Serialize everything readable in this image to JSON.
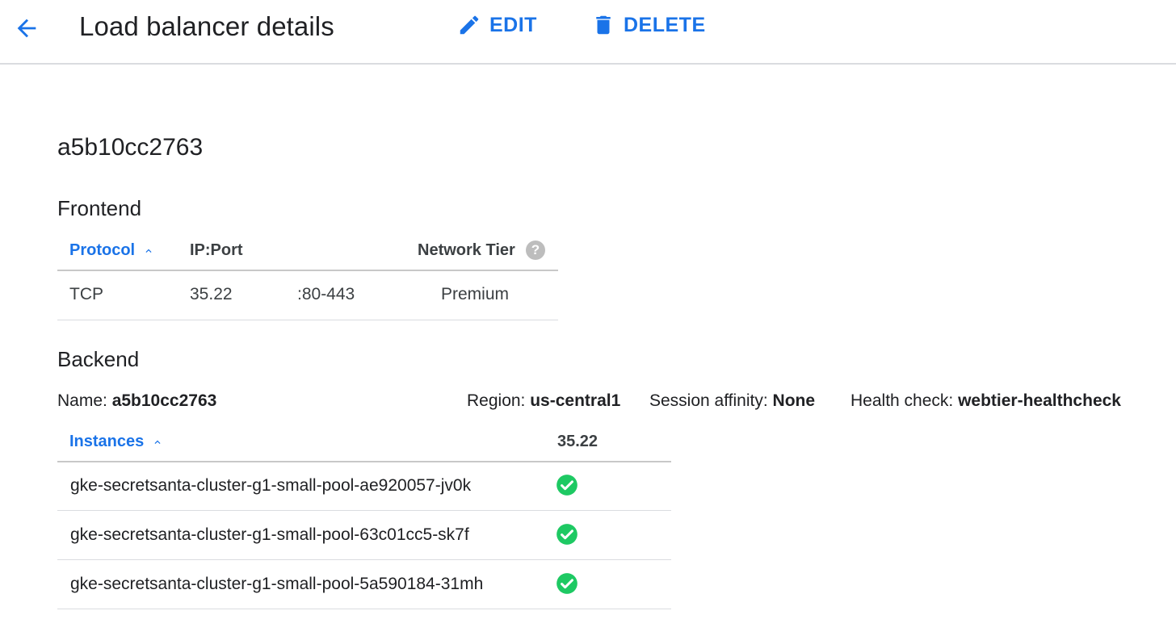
{
  "header": {
    "title": "Load balancer details",
    "edit_label": "EDIT",
    "delete_label": "DELETE"
  },
  "lb_name": "a5b10cc2763",
  "frontend": {
    "section_title": "Frontend",
    "columns": {
      "protocol": "Protocol",
      "ip_port": "IP:Port",
      "network_tier": "Network Tier"
    },
    "rows": [
      {
        "protocol": "TCP",
        "ip": "35.22",
        "port": ":80-443",
        "tier": "Premium"
      }
    ]
  },
  "backend": {
    "section_title": "Backend",
    "name_label": "Name: ",
    "name_value": "a5b10cc2763",
    "region_label": "Region: ",
    "region_value": "us-central1",
    "session_label": "Session affinity: ",
    "session_value": "None",
    "health_label": "Health check: ",
    "health_value": "webtier-healthcheck",
    "columns": {
      "instances": "Instances",
      "ip": "35.22"
    },
    "instances": [
      {
        "name": "gke-secretsanta-cluster-g1-small-pool-ae920057-jv0k",
        "status": "healthy"
      },
      {
        "name": "gke-secretsanta-cluster-g1-small-pool-63c01cc5-sk7f",
        "status": "healthy"
      },
      {
        "name": "gke-secretsanta-cluster-g1-small-pool-5a590184-31mh",
        "status": "healthy"
      }
    ]
  },
  "icons": {
    "back": "arrow-back-icon",
    "edit": "pencil-icon",
    "delete": "trash-icon",
    "sort": "chevron-up-icon",
    "help": "help-icon",
    "healthy": "check-circle-icon"
  },
  "colors": {
    "accent": "#1a73e8",
    "healthy": "#1ec963",
    "divider": "#dadce0"
  },
  "help_glyph": "?"
}
